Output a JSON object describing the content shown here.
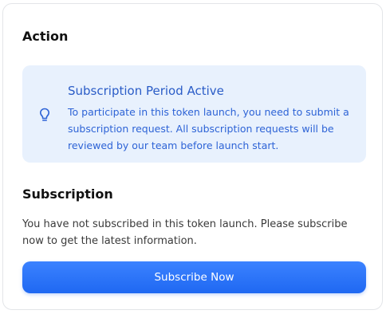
{
  "action": {
    "title": "Action",
    "notice": {
      "icon": "lightbulb-icon",
      "title": "Subscription Period Active",
      "body": "To participate in this token launch, you need to submit a subscription request. All subscription requests will be reviewed by our team before launch start."
    }
  },
  "subscription": {
    "title": "Subscription",
    "message": "You have not subscribed in this token launch. Please subscribe now to get the latest information.",
    "button_label": "Subscribe Now"
  },
  "colors": {
    "accent": "#1f68f2",
    "notice_background": "#e8f1fd",
    "notice_text": "#2d63d6"
  }
}
